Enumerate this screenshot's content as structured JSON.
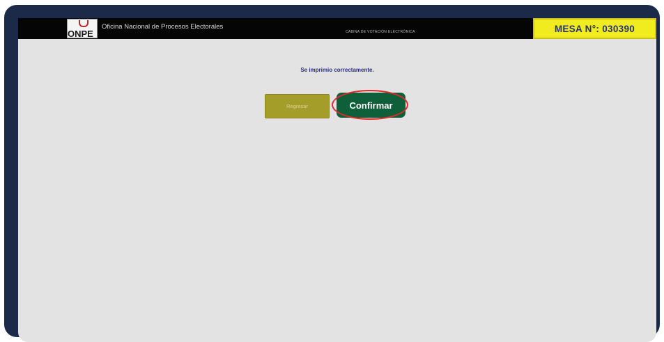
{
  "header": {
    "logo_text": "ONPE",
    "org_name": "Oficina Nacional de Procesos Electorales",
    "subtitle": "CABINA DE VOTACIÓN ELECTRÓNICA",
    "mesa_label": "MESA N°: 030390"
  },
  "main": {
    "message": "Se imprimio correctamente.",
    "regresar_label": "Regresar",
    "confirmar_label": "Confirmar"
  },
  "colors": {
    "frame": "#1c2a4a",
    "topbar": "#050505",
    "mesa_badge": "#f1ec1e",
    "regresar_button": "#a59d2a",
    "confirmar_button": "#0f5f3a",
    "highlight": "#e02a2a"
  }
}
